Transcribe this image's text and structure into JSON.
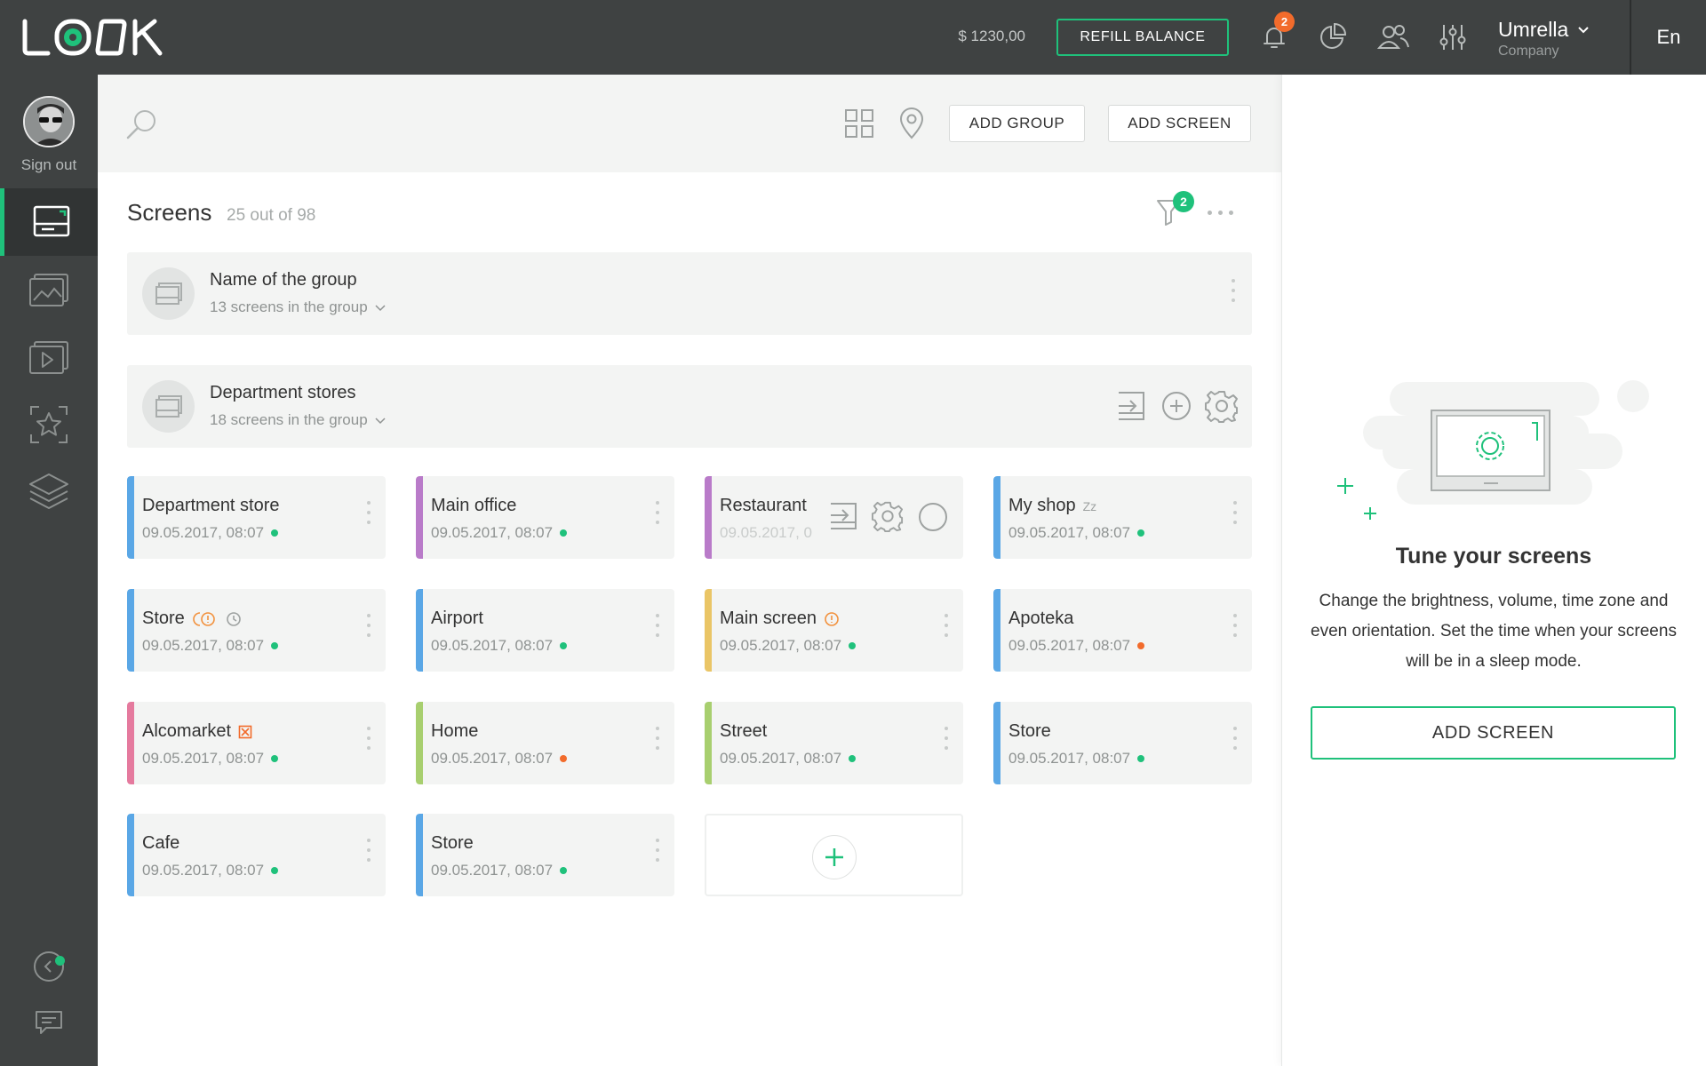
{
  "header": {
    "logo_text": "LOOK",
    "balance": "$ 1230,00",
    "refill_label": "REFILL BALANCE",
    "notification_count": "2",
    "user_name": "Umrella",
    "user_role": "Company",
    "language": "En",
    "icons": [
      "bell-icon",
      "pie-chart-icon",
      "users-icon",
      "sliders-icon",
      "chevron-down-icon"
    ]
  },
  "sidebar": {
    "sign_out_label": "Sign out",
    "items": [
      {
        "id": "screens",
        "icon": "screen-icon",
        "active": true
      },
      {
        "id": "images",
        "icon": "image-icon",
        "active": false
      },
      {
        "id": "videos",
        "icon": "video-icon",
        "active": false
      },
      {
        "id": "featured",
        "icon": "star-icon",
        "active": false
      },
      {
        "id": "layers",
        "icon": "layers-icon",
        "active": false
      }
    ],
    "bottom_icons": [
      "collapse-icon",
      "chat-icon"
    ]
  },
  "toolbar": {
    "add_group_label": "ADD GROUP",
    "add_screen_label": "ADD SCREEN",
    "icons": [
      "search-icon",
      "grid-view-icon",
      "map-pin-icon"
    ]
  },
  "main": {
    "title": "Screens",
    "count": "25 out of 98",
    "filter_count": "2",
    "groups": [
      {
        "name": "Name of the group",
        "sub": "13 screens in the group"
      },
      {
        "name": "Department stores",
        "sub": "18 screens in the group"
      }
    ],
    "cards": [
      {
        "name": "Department store",
        "date": "09.05.2017, 08:07",
        "status": "online"
      },
      {
        "name": "Main office",
        "date": "09.05.2017, 08:07",
        "status": "online"
      },
      {
        "name": "Restaurant",
        "date": "09.05.2017, 0",
        "status": "online"
      },
      {
        "name": "My shop",
        "date": "09.05.2017, 08:07",
        "status": "online",
        "badge": "Zz"
      },
      {
        "name": "Store",
        "date": "09.05.2017, 08:07",
        "status": "online"
      },
      {
        "name": "Airport",
        "date": "09.05.2017, 08:07",
        "status": "online"
      },
      {
        "name": "Main screen",
        "date": "09.05.2017, 08:07",
        "status": "online"
      },
      {
        "name": "Apoteka",
        "date": "09.05.2017, 08:07",
        "status": "offline"
      },
      {
        "name": "Alcomarket",
        "date": "09.05.2017, 08:07",
        "status": "online"
      },
      {
        "name": "Home",
        "date": "09.05.2017, 08:07",
        "status": "offline"
      },
      {
        "name": "Street",
        "date": "09.05.2017, 08:07",
        "status": "online"
      },
      {
        "name": "Store",
        "date": "09.05.2017, 08:07",
        "status": "online"
      },
      {
        "name": "Cafe",
        "date": "09.05.2017, 08:07",
        "status": "online"
      },
      {
        "name": "Store",
        "date": "09.05.2017, 08:07",
        "status": "online"
      }
    ]
  },
  "panel": {
    "title": "Tune your screens",
    "description": "Change the brightness, volume, time zone and even orientation. Set the time when your screens will be in a sleep mode.",
    "add_screen_label": "ADD SCREEN"
  },
  "colors": {
    "accent": "#1fc17b",
    "dark": "#3f4242",
    "warning": "#f26b2b",
    "bar_blue": "#5aa7e6",
    "bar_purple": "#b97bc9",
    "bar_yellow": "#eac566",
    "bar_pink": "#e57a9e",
    "bar_green": "#a8cf6f"
  }
}
